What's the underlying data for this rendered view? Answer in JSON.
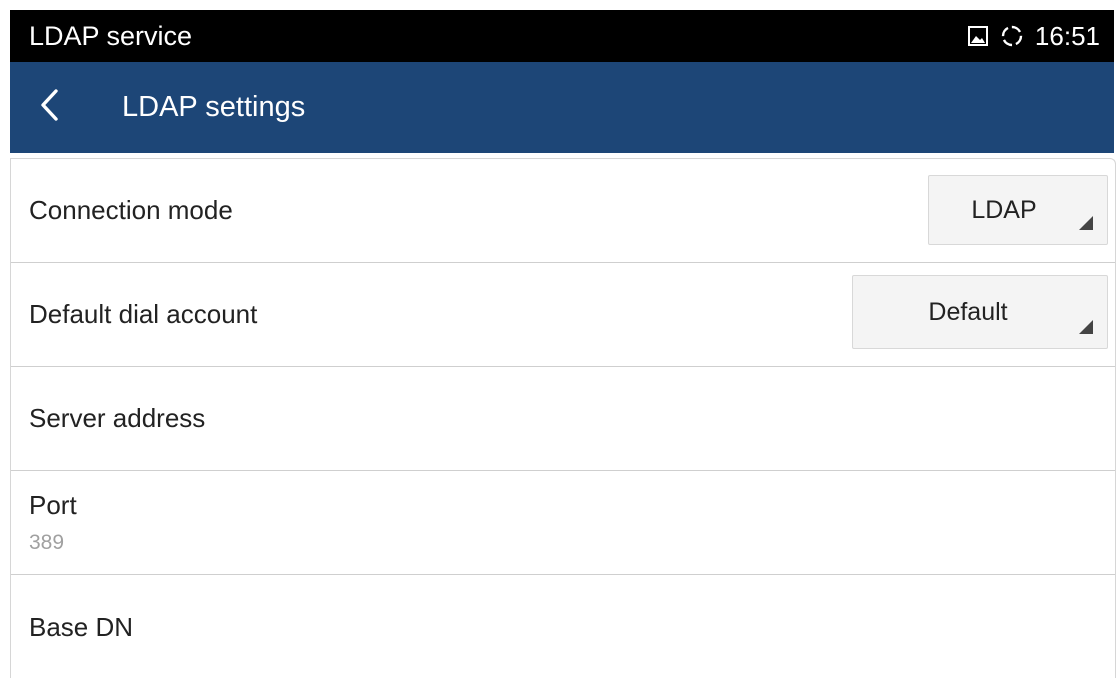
{
  "status_bar": {
    "title": "LDAP service",
    "time": "16:51",
    "icons": [
      "image-icon",
      "sync-icon"
    ]
  },
  "app_bar": {
    "back_icon": "chevron-left-icon",
    "title": "LDAP settings",
    "color": "#1d4677"
  },
  "settings": {
    "connection_mode": {
      "label": "Connection mode",
      "value": "LDAP"
    },
    "default_dial_account": {
      "label": "Default dial account",
      "value": "Default"
    },
    "server_address": {
      "label": "Server address"
    },
    "port": {
      "label": "Port",
      "value": "389"
    },
    "base_dn": {
      "label": "Base DN"
    }
  }
}
